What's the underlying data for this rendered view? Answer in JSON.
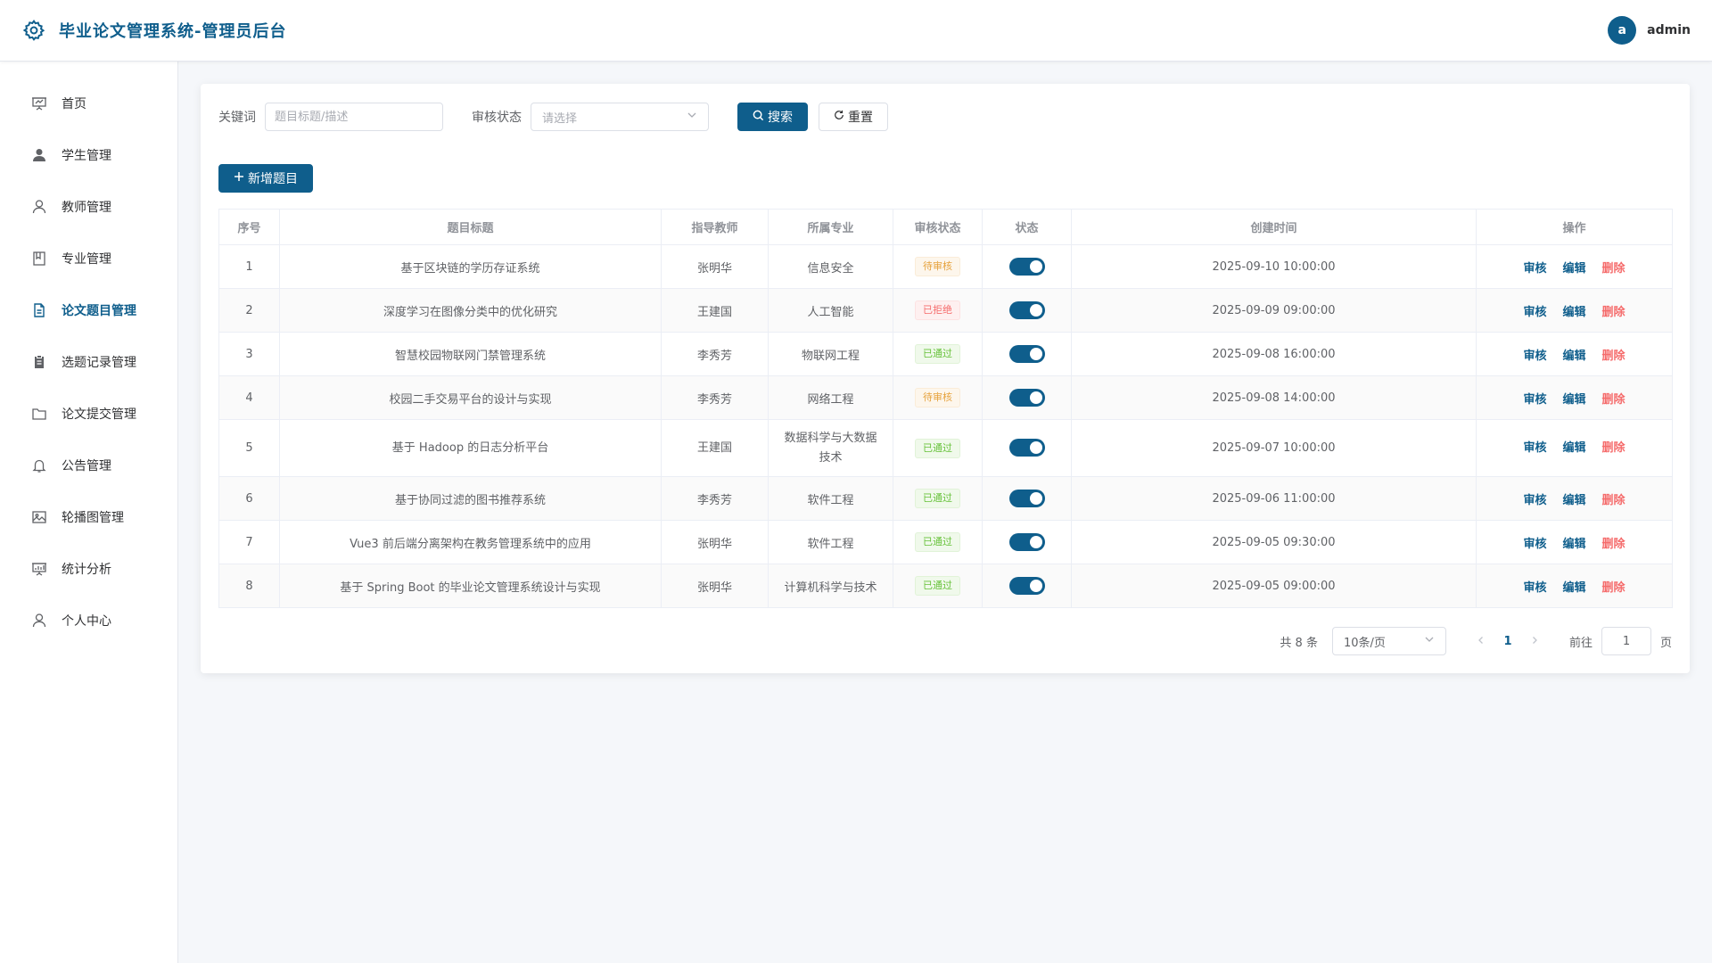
{
  "header": {
    "title": "毕业论文管理系统-管理员后台",
    "avatar_letter": "a",
    "username": "admin"
  },
  "sidebar": {
    "items": [
      {
        "label": "首页",
        "icon": "presentation-icon"
      },
      {
        "label": "学生管理",
        "icon": "user-filled-icon"
      },
      {
        "label": "教师管理",
        "icon": "user-icon"
      },
      {
        "label": "专业管理",
        "icon": "notebook-icon"
      },
      {
        "label": "论文题目管理",
        "icon": "document-icon",
        "active": true
      },
      {
        "label": "选题记录管理",
        "icon": "clipboard-icon"
      },
      {
        "label": "论文提交管理",
        "icon": "folder-icon"
      },
      {
        "label": "公告管理",
        "icon": "bell-icon"
      },
      {
        "label": "轮播图管理",
        "icon": "picture-icon"
      },
      {
        "label": "统计分析",
        "icon": "chart-icon"
      },
      {
        "label": "个人中心",
        "icon": "user-icon"
      }
    ]
  },
  "filters": {
    "keyword_label": "关键词",
    "keyword_placeholder": "题目标题/描述",
    "status_label": "审核状态",
    "status_placeholder": "请选择",
    "search_label": "搜索",
    "reset_label": "重置",
    "add_label": "新增题目"
  },
  "table": {
    "headers": [
      "序号",
      "题目标题",
      "指导教师",
      "所属专业",
      "审核状态",
      "状态",
      "创建时间",
      "操作"
    ],
    "rows": [
      {
        "no": "1",
        "title": "基于区块链的学历存证系统",
        "teacher": "张明华",
        "major": "信息安全",
        "status": "待审核",
        "time": "2025-09-10 10:00:00"
      },
      {
        "no": "2",
        "title": "深度学习在图像分类中的优化研究",
        "teacher": "王建国",
        "major": "人工智能",
        "status": "已拒绝",
        "time": "2025-09-09 09:00:00"
      },
      {
        "no": "3",
        "title": "智慧校园物联网门禁管理系统",
        "teacher": "李秀芳",
        "major": "物联网工程",
        "status": "已通过",
        "time": "2025-09-08 16:00:00"
      },
      {
        "no": "4",
        "title": "校园二手交易平台的设计与实现",
        "teacher": "李秀芳",
        "major": "网络工程",
        "status": "待审核",
        "time": "2025-09-08 14:00:00"
      },
      {
        "no": "5",
        "title": "基于 Hadoop 的日志分析平台",
        "teacher": "王建国",
        "major": "数据科学与大数据技术",
        "status": "已通过",
        "time": "2025-09-07 10:00:00"
      },
      {
        "no": "6",
        "title": "基于协同过滤的图书推荐系统",
        "teacher": "李秀芳",
        "major": "软件工程",
        "status": "已通过",
        "time": "2025-09-06 11:00:00"
      },
      {
        "no": "7",
        "title": "Vue3 前后端分离架构在教务管理系统中的应用",
        "teacher": "张明华",
        "major": "软件工程",
        "status": "已通过",
        "time": "2025-09-05 09:30:00"
      },
      {
        "no": "8",
        "title": "基于 Spring Boot 的毕业论文管理系统设计与实现",
        "teacher": "张明华",
        "major": "计算机科学与技术",
        "status": "已通过",
        "time": "2025-09-05 09:00:00"
      }
    ],
    "actions": {
      "review": "审核",
      "edit": "编辑",
      "delete": "删除"
    }
  },
  "pagination": {
    "total_text": "共 8 条",
    "page_size": "10条/页",
    "current_page": "1",
    "goto_label": "前往",
    "goto_value": "1",
    "page_suffix": "页"
  },
  "colors": {
    "primary": "#0f5e8c",
    "pending": "#e6a23c",
    "rejected": "#f56c6c",
    "approved": "#67c23a"
  }
}
